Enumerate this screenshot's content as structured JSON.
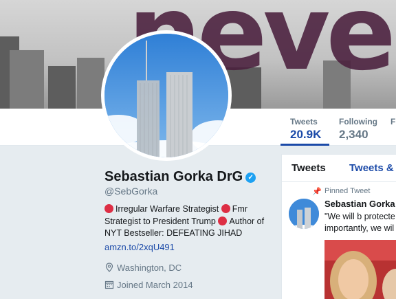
{
  "banner": {
    "text": "neve"
  },
  "profile": {
    "name": "Sebastian Gorka DrG",
    "handle": "@SebGorka",
    "bio_parts": [
      "Irregular Warfare Strategist",
      "Fmr Strategist to President Trump",
      "Author of NYT Bestseller: DEFEATING JIHAD"
    ],
    "link": "amzn.to/2xqU491",
    "location": "Washington, DC",
    "joined": "Joined March 2014"
  },
  "stats": [
    {
      "label": "Tweets",
      "value": "20.9K",
      "active": true
    },
    {
      "label": "Following",
      "value": "2,340",
      "active": false
    },
    {
      "label": "F",
      "value": "",
      "active": false
    }
  ],
  "timeline": {
    "tabs": [
      "Tweets",
      "Tweets &"
    ],
    "pinned_label": "Pinned Tweet",
    "author": "Sebastian Gorka",
    "text_line1": "\"We will b protecte",
    "text_line2": "importantly, we wil"
  },
  "icons": {
    "verified": "verified-badge",
    "location": "location-pin-icon",
    "calendar": "calendar-icon",
    "pin": "pin-icon"
  },
  "colors": {
    "accent": "#1b4aa8",
    "verified": "#1da1f2",
    "dot": "#dd2e44"
  }
}
